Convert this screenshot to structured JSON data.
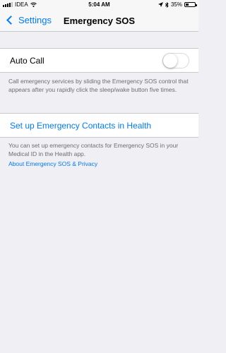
{
  "status_bar": {
    "carrier": "IDEA",
    "time": "5:04 AM",
    "battery_percent_label": "35%",
    "battery_level": 0.35
  },
  "nav": {
    "back_label": "Settings",
    "title": "Emergency SOS"
  },
  "auto_call": {
    "label": "Auto Call",
    "enabled": false,
    "description": "Call emergency services by sliding the Emergency SOS control that appears after you rapidly click the sleep/wake button five times."
  },
  "contacts": {
    "setup_link": "Set up Emergency Contacts in Health",
    "description": "You can set up emergency contacts for Emergency SOS in your Medical ID in the Health app.",
    "about_link": "About Emergency SOS & Privacy"
  },
  "colors": {
    "accent": "#007aff",
    "background": "#efeff4",
    "secondary_text": "#6d6d72"
  }
}
